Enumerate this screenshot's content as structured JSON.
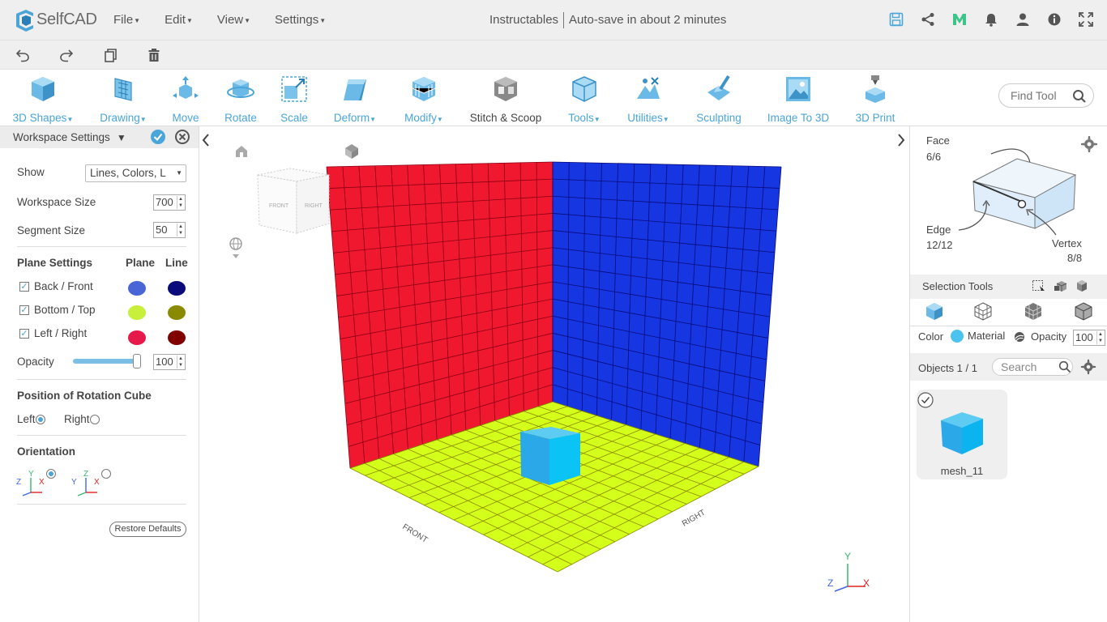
{
  "app": {
    "name": "SelfCAD",
    "brand_color": "#4aa5d9"
  },
  "menu": [
    {
      "label": "File"
    },
    {
      "label": "Edit"
    },
    {
      "label": "View"
    },
    {
      "label": "Settings"
    }
  ],
  "document": {
    "name": "Instructables",
    "autosave": "Auto-save in about 2 minutes"
  },
  "top_icons": [
    "save-icon",
    "share-icon",
    "m-logo-icon",
    "bell-icon",
    "user-icon",
    "info-icon",
    "fullscreen-icon"
  ],
  "quick_actions": [
    "undo-icon",
    "redo-icon",
    "copy-icon",
    "delete-icon"
  ],
  "tools": [
    {
      "label": "3D Shapes",
      "caret": true
    },
    {
      "label": "Drawing",
      "caret": true
    },
    {
      "label": "Move",
      "caret": false
    },
    {
      "label": "Rotate",
      "caret": false
    },
    {
      "label": "Scale",
      "caret": false
    },
    {
      "label": "Deform",
      "caret": true
    },
    {
      "label": "Modify",
      "caret": true
    },
    {
      "label": "Stitch & Scoop",
      "caret": false
    },
    {
      "label": "Tools",
      "caret": true
    },
    {
      "label": "Utilities",
      "caret": true
    },
    {
      "label": "Sculpting",
      "caret": false
    },
    {
      "label": "Image To 3D",
      "caret": false
    },
    {
      "label": "3D Print",
      "caret": false
    }
  ],
  "find_tool": {
    "placeholder": "Find Tool"
  },
  "workspace_settings": {
    "title": "Workspace Settings",
    "show_label": "Show",
    "show_value": "Lines, Colors, L",
    "workspace_size_label": "Workspace Size",
    "workspace_size_value": "700",
    "segment_size_label": "Segment Size",
    "segment_size_value": "50",
    "plane_settings_label": "Plane Settings",
    "plane_col": "Plane",
    "line_col": "Line",
    "planes": [
      {
        "label": "Back / Front",
        "checked": true,
        "plane_color": "#4a66d6",
        "line_color": "#0a0a7a"
      },
      {
        "label": "Bottom / Top",
        "checked": true,
        "plane_color": "#c8f03a",
        "line_color": "#8a8a00"
      },
      {
        "label": "Left / Right",
        "checked": true,
        "plane_color": "#e6194b",
        "line_color": "#800000"
      }
    ],
    "opacity_label": "Opacity",
    "opacity_value": "100",
    "rotation_cube_label": "Position of Rotation Cube",
    "left_label": "Left",
    "right_label": "Right",
    "rotation_cube_position": "Left",
    "orientation_label": "Orientation",
    "restore_label": "Restore Defaults"
  },
  "viewport": {
    "cube_face_front": "FRONT",
    "cube_face_right": "RIGHT",
    "floor_label_front": "FRONT",
    "floor_label_right": "RIGHT",
    "axis_x": "X",
    "axis_y": "Y",
    "axis_z": "Z"
  },
  "selection": {
    "face_label": "Face",
    "face_count": "6/6",
    "edge_label": "Edge",
    "edge_count": "12/12",
    "vertex_label": "Vertex",
    "vertex_count": "8/8",
    "tools_label": "Selection Tools",
    "color_label": "Color",
    "color_value": "#4cc3ef",
    "material_label": "Material",
    "opacity_label": "Opacity",
    "opacity_value": "100"
  },
  "objects": {
    "label": "Objects 1 / 1",
    "search_placeholder": "Search",
    "items": [
      {
        "name": "mesh_11"
      }
    ]
  }
}
